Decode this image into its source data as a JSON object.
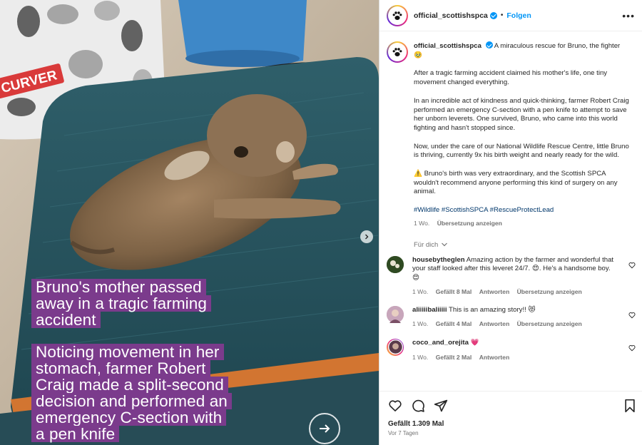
{
  "media": {
    "bin_brand": "CURVER",
    "caption_lines_1": [
      "Bruno's mother passed",
      "away in a tragic farming",
      "accident"
    ],
    "caption_lines_2": [
      "Noticing movement in her",
      "stomach, farmer Robert",
      "Craig made a split-second",
      "decision and performed an",
      "emergency C-section with",
      "a pen knife"
    ]
  },
  "header": {
    "username": "official_scottishspca",
    "separator": "•",
    "follow": "Folgen",
    "more": "•••"
  },
  "post": {
    "username": "official_scottishspca",
    "intro": "A miraculous rescue for Bruno, the fighter",
    "intro_emoji": "🥹",
    "p1": "After a tragic farming accident claimed his mother's life, one tiny movement changed everything.",
    "p2": "In an incredible act of kindness and quick-thinking, farmer Robert Craig performed an emergency C-section with a pen knife to attempt to save her unborn leverets. One survived, Bruno, who came into this world fighting and hasn't stopped since.",
    "p3": "Now, under the care of our National Wildlife Rescue Centre, little Bruno is thriving, currently 9x his birth weight and nearly ready for the wild.",
    "warning_emoji": "⚠️",
    "p4": "Bruno's birth was very extraordinary, and the Scottish SPCA wouldn't recommend anyone performing this kind of surgery on any animal.",
    "hashtags": "#Wildlife #ScottishSPCA #RescueProtectLead",
    "time": "1 Wo.",
    "translate": "Übersetzung anzeigen"
  },
  "fuer_dich": "Für dich",
  "comments": [
    {
      "username": "housebytheglen",
      "text": "Amazing action by the farmer and wonderful that your staff looked after this leveret 24/7.",
      "emoji1": "😍",
      "text2": ". He's a handsome boy.",
      "emoji2": "😍",
      "time": "1 Wo.",
      "likes": "Gefällt 8 Mal",
      "reply": "Antworten",
      "translate": "Übersetzung anzeigen",
      "avatar_color": "#3f5a2c"
    },
    {
      "username": "aliiiiibaliiiii",
      "text": "This is an amazing story!!",
      "emoji1": "😻",
      "time": "1 Wo.",
      "likes": "Gefällt 4 Mal",
      "reply": "Antworten",
      "translate": "Übersetzung anzeigen",
      "avatar_color": "#b08da5"
    },
    {
      "username": "coco_and_orejita",
      "text": "",
      "emoji1": "💗",
      "time": "1 Wo.",
      "likes": "Gefällt 2 Mal",
      "reply": "Antworten",
      "avatar_color": "#5a3a4a"
    }
  ],
  "actions": {
    "likes": "Gefällt 1.309 Mal",
    "ago": "Vor 7 Tagen"
  }
}
